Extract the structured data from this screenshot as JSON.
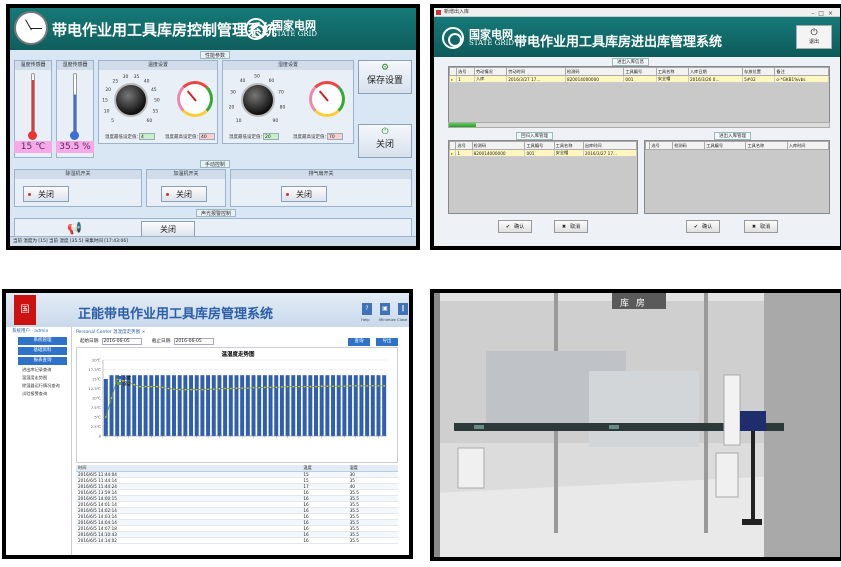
{
  "control_panel": {
    "title": "带电作业用工具库房控制管理系统",
    "logo_cn": "国家电网",
    "logo_en": "STATE GRID",
    "section_params": "性能参数",
    "temp_sensor_label": "温度传感器",
    "humidity_sensor_label": "湿度传感器",
    "temp_readout": "15 ℃",
    "humidity_readout": "35.5 %",
    "temp_setting_label": "温度设置",
    "humidity_setting_label": "湿度设置",
    "temp_dial_ticks": [
      "5",
      "10",
      "15",
      "20",
      "25",
      "30",
      "35",
      "40",
      "45",
      "50",
      "55",
      "60"
    ],
    "humidity_dial_ticks": [
      "10",
      "20",
      "30",
      "40",
      "50",
      "60",
      "70",
      "80",
      "90"
    ],
    "temp_low_label": "温度最低设定值：",
    "temp_low_value": "4",
    "temp_high_label": "温度最高设定值：",
    "temp_high_value": "40",
    "hum_low_label": "湿度最低设定值：",
    "hum_low_value": "20",
    "hum_high_label": "湿度最高设定值：",
    "hum_high_value": "70",
    "save_label": "保存设置",
    "close_label": "关闭",
    "section_manual": "手动控制",
    "dehumidifier_label": "除湿机开关",
    "heater_label": "加温机开关",
    "exhaust_label": "排气扇开关",
    "switch_off": "关闭",
    "section_alarm": "声光报警控制",
    "alarm_switch": "关闭",
    "status": "当前 温度为 [15] 当前 湿度 [35.5] 采集时间 [17:43:06]"
  },
  "inout_panel": {
    "window_title": "新增出入库",
    "logo_cn": "国家电网",
    "logo_en": "STATE GRID",
    "title": "带电作业用工具库房进出库管理系统",
    "exit_label": "退出",
    "top_grid_caption": "进出入库信息",
    "top_columns": [
      "选号",
      "劳动情况",
      "劳动时间",
      "检测码",
      "工具编号",
      "工具名称",
      "入库日期",
      "存放位置",
      "备注"
    ],
    "top_rows": [
      [
        "1",
        "入库",
        "2016/3/27 17...",
        "820014000000",
        "001",
        "安全帽",
        "2016/3/26 0...",
        "5#02",
        "o-*GKB1%vbs"
      ]
    ],
    "progress": 0.07,
    "left_grid_caption": "回归入库管理",
    "right_grid_caption": "进出入库管理",
    "left_columns": [
      "选号",
      "检测码",
      "工具编号",
      "工具名称",
      "出库时间"
    ],
    "left_rows": [
      [
        "1",
        "820014000000",
        "001",
        "安全帽",
        "2016/3/27 17..."
      ]
    ],
    "right_columns": [
      "选号",
      "检测码",
      "工具编号",
      "工具名称",
      "入库时间"
    ],
    "confirm_label": "确认",
    "cancel_label": "取消"
  },
  "energy_panel": {
    "logo_text": "国",
    "title": "正能带电作业用工具库房管理系统",
    "icons": [
      {
        "label": "Help",
        "glyph": "?"
      },
      {
        "label": "Minimize",
        "glyph": "▣"
      },
      {
        "label": "Close",
        "glyph": "‖"
      }
    ],
    "side_header": "系统用户 · admin",
    "nav": [
      {
        "label": "系统管理",
        "type": "button"
      },
      {
        "label": "基础资料",
        "type": "button"
      },
      {
        "label": "报表查询",
        "type": "button"
      },
      {
        "label": "进出库记录查询",
        "type": "sub"
      },
      {
        "label": "温湿度走势图",
        "type": "sub"
      },
      {
        "label": "除湿器运行情况查询",
        "type": "sub"
      },
      {
        "label": "试验报警查询",
        "type": "sub"
      }
    ],
    "breadcrumb": "Personal Center  温湿度走势图 ×",
    "start_label": "起始日期:",
    "start_value": "2016-06-05",
    "end_label": "截止日期:",
    "end_value": "2016-06-05",
    "query_label": "查询",
    "export_label": "导出",
    "table_columns": [
      "时间",
      "温度",
      "湿度"
    ],
    "table_rows": [
      [
        "2016/6/5 11:44:04",
        "15",
        "30"
      ],
      [
        "2016/6/5 11:44:14",
        "15",
        "35"
      ],
      [
        "2016/6/5 11:44:24",
        "17",
        "40"
      ],
      [
        "2016/6/5 13:59:14",
        "16",
        "35.5"
      ],
      [
        "2016/6/5 14:00:15",
        "16",
        "35.5"
      ],
      [
        "2016/6/5 14:01:14",
        "16",
        "35.5"
      ],
      [
        "2016/6/5 14:02:14",
        "16",
        "35.5"
      ],
      [
        "2016/6/5 14:03:14",
        "16",
        "35.5"
      ],
      [
        "2016/6/5 14:04:14",
        "16",
        "35.5"
      ],
      [
        "2016/6/5 14:07:18",
        "16",
        "35.5"
      ],
      [
        "2016/6/5 14:10:43",
        "16",
        "35.5"
      ],
      [
        "2016/6/5 14:14:02",
        "16",
        "35.5"
      ]
    ]
  },
  "chart_data": {
    "type": "bar",
    "title": "温湿度走势图",
    "legend": [
      "温度",
      "湿度"
    ],
    "legend_position": "top-left",
    "y_left_ticks": [
      "0",
      "2.5℃",
      "5℃",
      "7.5℃",
      "10℃",
      "12.5℃",
      "15℃",
      "17.5℃",
      "20℃"
    ],
    "ylim": [
      0,
      20
    ],
    "bar_values": [
      15,
      16,
      16,
      16,
      16,
      16,
      16,
      16,
      16,
      16,
      16,
      16,
      16,
      16,
      16,
      16,
      16,
      16,
      16,
      16,
      16,
      16,
      16,
      16,
      16,
      16,
      16,
      16,
      16,
      16,
      16,
      16,
      16,
      16,
      16,
      16,
      16,
      16,
      16,
      16,
      16,
      16,
      16,
      16,
      16,
      16,
      16,
      16,
      16,
      16
    ],
    "line_values": [
      5,
      10,
      15,
      14.5,
      14,
      13.5,
      13,
      13,
      13,
      13,
      12.8,
      12.5,
      12.3,
      12.2,
      12.2,
      12.2,
      12.2,
      12.2,
      12.3,
      12.3,
      12.4,
      12.5,
      12.5,
      12.6,
      12.6,
      12.6,
      12.7,
      12.7,
      12.8,
      12.8,
      12.8,
      12.9,
      13,
      13,
      13,
      13,
      13,
      13,
      13.1,
      13.1,
      13.1,
      13.1,
      13.1,
      13.2,
      13.2,
      13.2,
      13.2,
      13.2,
      13.2,
      13.2
    ]
  },
  "photo_panel": {
    "sign_text": "库 房"
  }
}
